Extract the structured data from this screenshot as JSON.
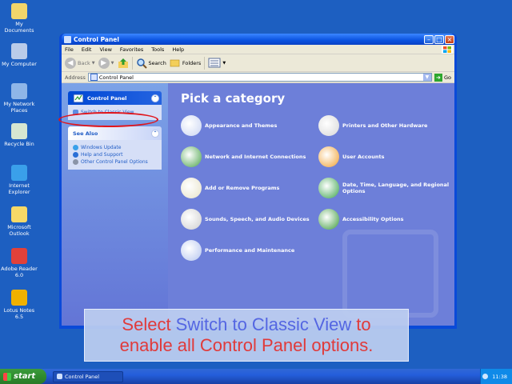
{
  "desktop": {
    "icons": [
      {
        "label": "My Documents",
        "icon": "folder-documents-icon",
        "color": "#f2d56a"
      },
      {
        "label": "My Computer",
        "icon": "computer-icon",
        "color": "#b9cbe9"
      },
      {
        "label": "My Network Places",
        "icon": "network-places-icon",
        "color": "#8fb6e8"
      },
      {
        "label": "Recycle Bin",
        "icon": "recycle-bin-icon",
        "color": "#d6e6d1"
      },
      {
        "label": "Internet Explorer",
        "icon": "internet-explorer-icon",
        "color": "#3aa0ea"
      },
      {
        "label": "Microsoft Outlook",
        "icon": "outlook-icon",
        "color": "#f7d967"
      },
      {
        "label": "Adobe Reader 6.0",
        "icon": "adobe-reader-icon",
        "color": "#e1413a"
      },
      {
        "label": "Lotus Notes 6.5",
        "icon": "lotus-notes-icon",
        "color": "#f0b100"
      }
    ]
  },
  "window": {
    "title": "Control Panel",
    "menu": [
      "File",
      "Edit",
      "View",
      "Favorites",
      "Tools",
      "Help"
    ],
    "toolbar": {
      "back": "Back",
      "search": "Search",
      "folders": "Folders"
    },
    "address": {
      "label": "Address",
      "value": "Control Panel",
      "go": "Go"
    }
  },
  "left_pane": {
    "control_panel": {
      "title": "Control Panel",
      "links": [
        "Switch to Classic View"
      ]
    },
    "see_also": {
      "title": "See Also",
      "links": [
        "Windows Update",
        "Help and Support",
        "Other Control Panel Options"
      ]
    }
  },
  "main": {
    "heading": "Pick a category",
    "categories": [
      {
        "label": "Appearance and Themes",
        "icon": "appearance-themes-icon",
        "color": "#c9d4f2"
      },
      {
        "label": "Printers and Other Hardware",
        "icon": "printer-icon",
        "color": "#d7d7d7"
      },
      {
        "label": "Network and Internet Connections",
        "icon": "network-connections-icon",
        "color": "#4aa24a"
      },
      {
        "label": "User Accounts",
        "icon": "user-accounts-icon",
        "color": "#f0a030"
      },
      {
        "label": "Add or Remove Programs",
        "icon": "add-remove-programs-icon",
        "color": "#e7e2c8"
      },
      {
        "label": "Date, Time, Language, and Regional Options",
        "icon": "date-time-globe-icon",
        "color": "#3aa34a"
      },
      {
        "label": "Sounds, Speech, and Audio Devices",
        "icon": "speaker-icon",
        "color": "#cfcfcf"
      },
      {
        "label": "Accessibility Options",
        "icon": "accessibility-icon",
        "color": "#3b9a3b"
      },
      {
        "label": "Performance and Maintenance",
        "icon": "performance-icon",
        "color": "#b5c5ef"
      }
    ]
  },
  "caption": {
    "line1": [
      "Select",
      "Switch to Classic View",
      "to"
    ],
    "line2": "enable all Control Panel options."
  },
  "taskbar": {
    "start": "start",
    "task": "Control Panel",
    "clock": "11:38"
  }
}
